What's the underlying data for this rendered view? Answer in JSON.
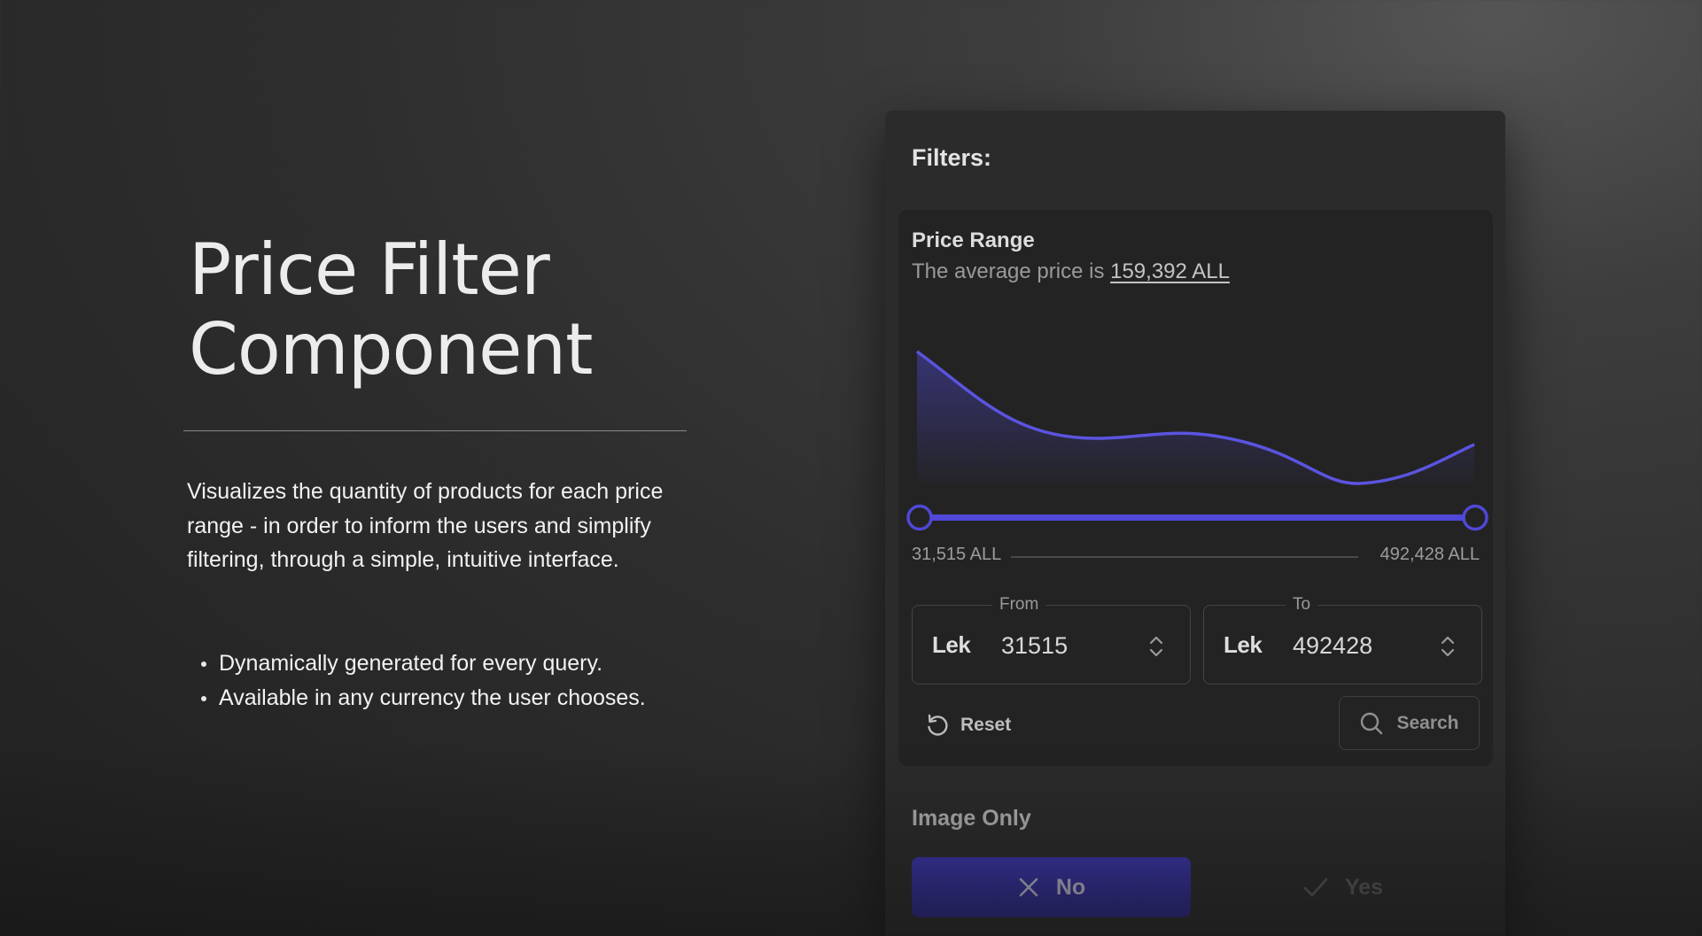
{
  "hero": {
    "title_line1": "Price Filter",
    "title_line2": "Component",
    "description": "Visualizes the quantity of products for each price range - in order to inform the users and simplify filtering, through a simple, intuitive interface.",
    "bullets": [
      "Dynamically generated for every query.",
      "Available in any currency the user chooses."
    ]
  },
  "filters": {
    "title": "Filters:",
    "price_range": {
      "title": "Price Range",
      "subtitle_prefix": "The average price is ",
      "average_price": "159,392 ALL",
      "min_label": "31,515 ALL",
      "max_label": "492,428 ALL",
      "slider_low_fraction": 0,
      "slider_high_fraction": 1,
      "from": {
        "legend": "From",
        "currency": "Lek",
        "value": "31515"
      },
      "to": {
        "legend": "To",
        "currency": "Lek",
        "value": "492428"
      },
      "reset_label": "Reset",
      "search_label": "Search"
    },
    "image_only": {
      "title": "Image Only",
      "options": [
        {
          "label": "No",
          "icon": "x-icon",
          "selected": true
        },
        {
          "label": "Yes",
          "icon": "check-icon",
          "selected": false
        }
      ]
    }
  },
  "colors": {
    "accent": "#4f48d8",
    "accent_dark": "#2d2890",
    "panel": "#2b2b2b",
    "card": "#232323"
  }
}
